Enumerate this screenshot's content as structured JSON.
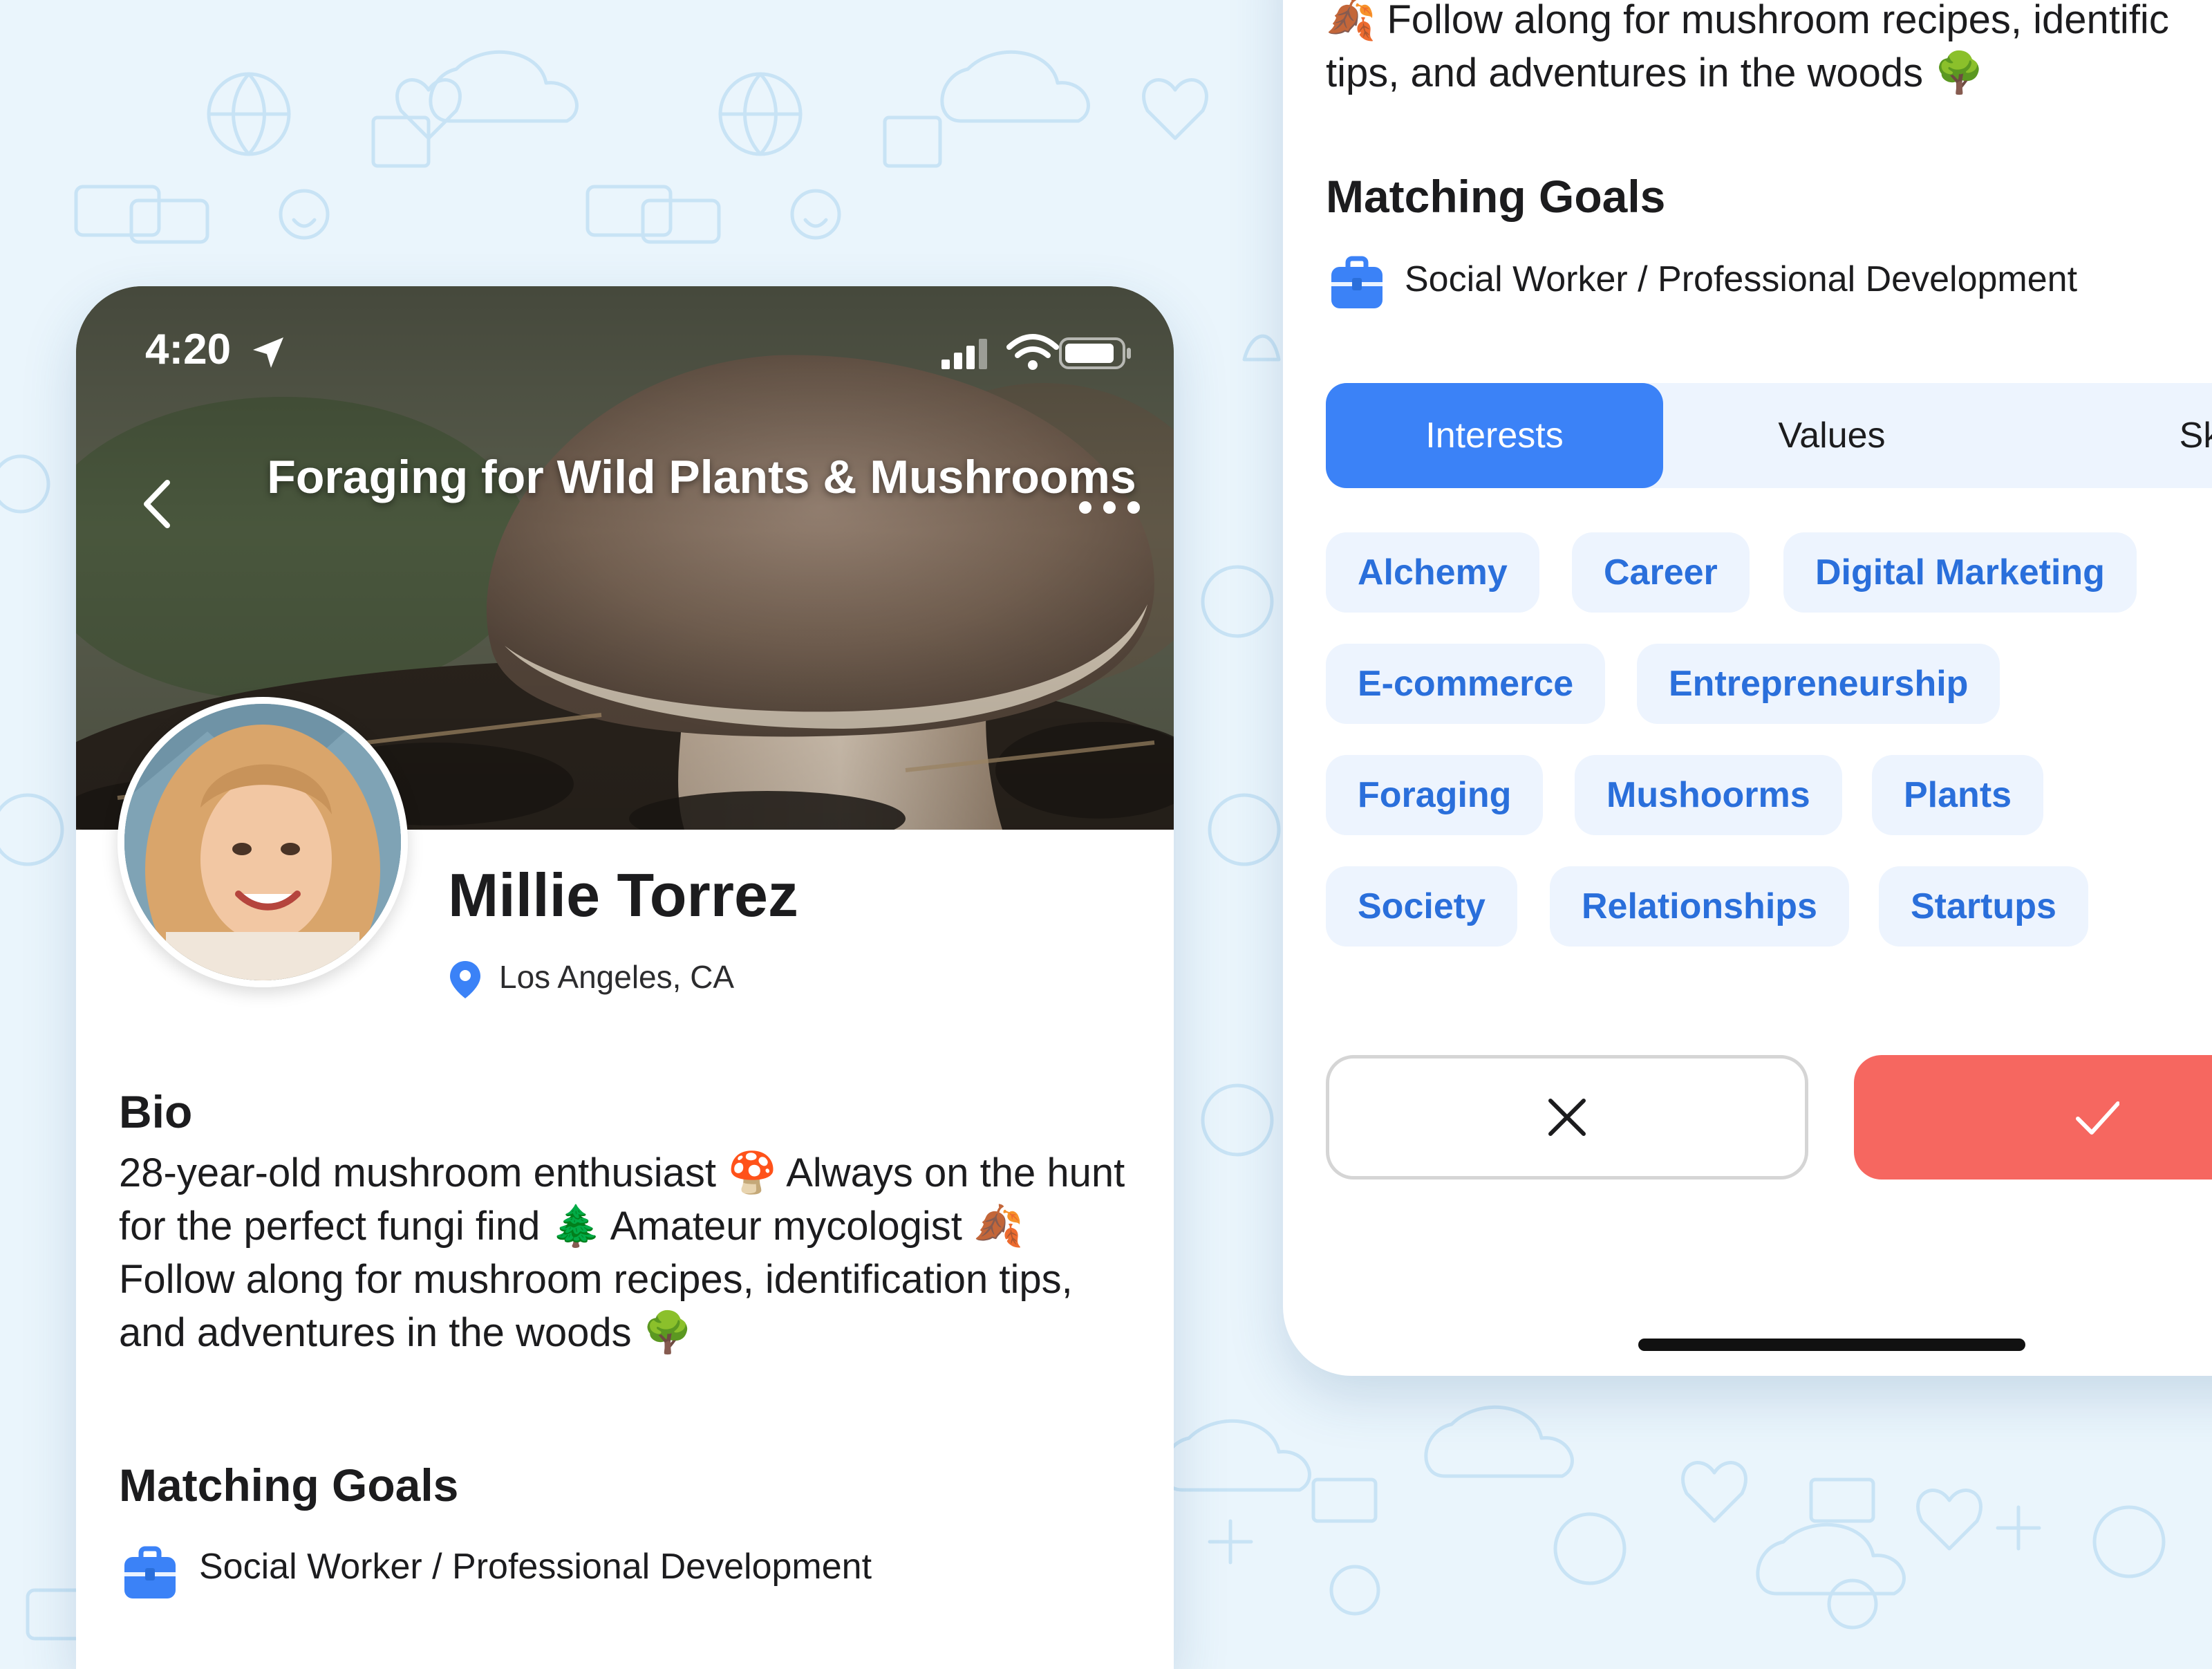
{
  "colors": {
    "background": "#eaf5fc",
    "accent_blue": "#3b82f7",
    "chip_text": "#2a6fdb",
    "chip_bg": "#edf4fe",
    "confirm_red": "#f66760"
  },
  "status_bar": {
    "time": "4:20",
    "icons": [
      "location-arrow-icon",
      "cellular-signal-icon",
      "wifi-icon",
      "battery-icon"
    ]
  },
  "header": {
    "title": "Foraging for Wild Plants & Mushrooms",
    "back_icon": "chevron-left-icon",
    "menu_icon": "more-horizontal-icon"
  },
  "profile": {
    "name": "Millie Torrez",
    "location": "Los Angeles, CA"
  },
  "bio": {
    "heading": "Bio",
    "text": "28-year-old mushroom enthusiast 🍄 Always on the hunt for the perfect fungi find 🌲 Amateur mycologist 🍂 Follow along for mushroom recipes, identification tips, and adventures in the woods 🌳",
    "continued_line_1": "🍂 Follow along for mushroom recipes, identific",
    "continued_line_2": "tips, and adventures in the woods 🌳"
  },
  "matching_goals": {
    "heading": "Matching Goals",
    "goal": "Social Worker / Professional Development"
  },
  "tabs": [
    {
      "label": "Interests",
      "active": true
    },
    {
      "label": "Values",
      "active": false
    },
    {
      "label": "Skills",
      "active": false
    }
  ],
  "interests": [
    "Alchemy",
    "Career",
    "Digital Marketing",
    "E-commerce",
    "Entrepreneurship",
    "Foraging",
    "Mushoorms",
    "Plants",
    "Society",
    "Relationships",
    "Startups"
  ],
  "actions": {
    "reject_icon": "close-icon",
    "accept_icon": "checkmark-icon"
  }
}
